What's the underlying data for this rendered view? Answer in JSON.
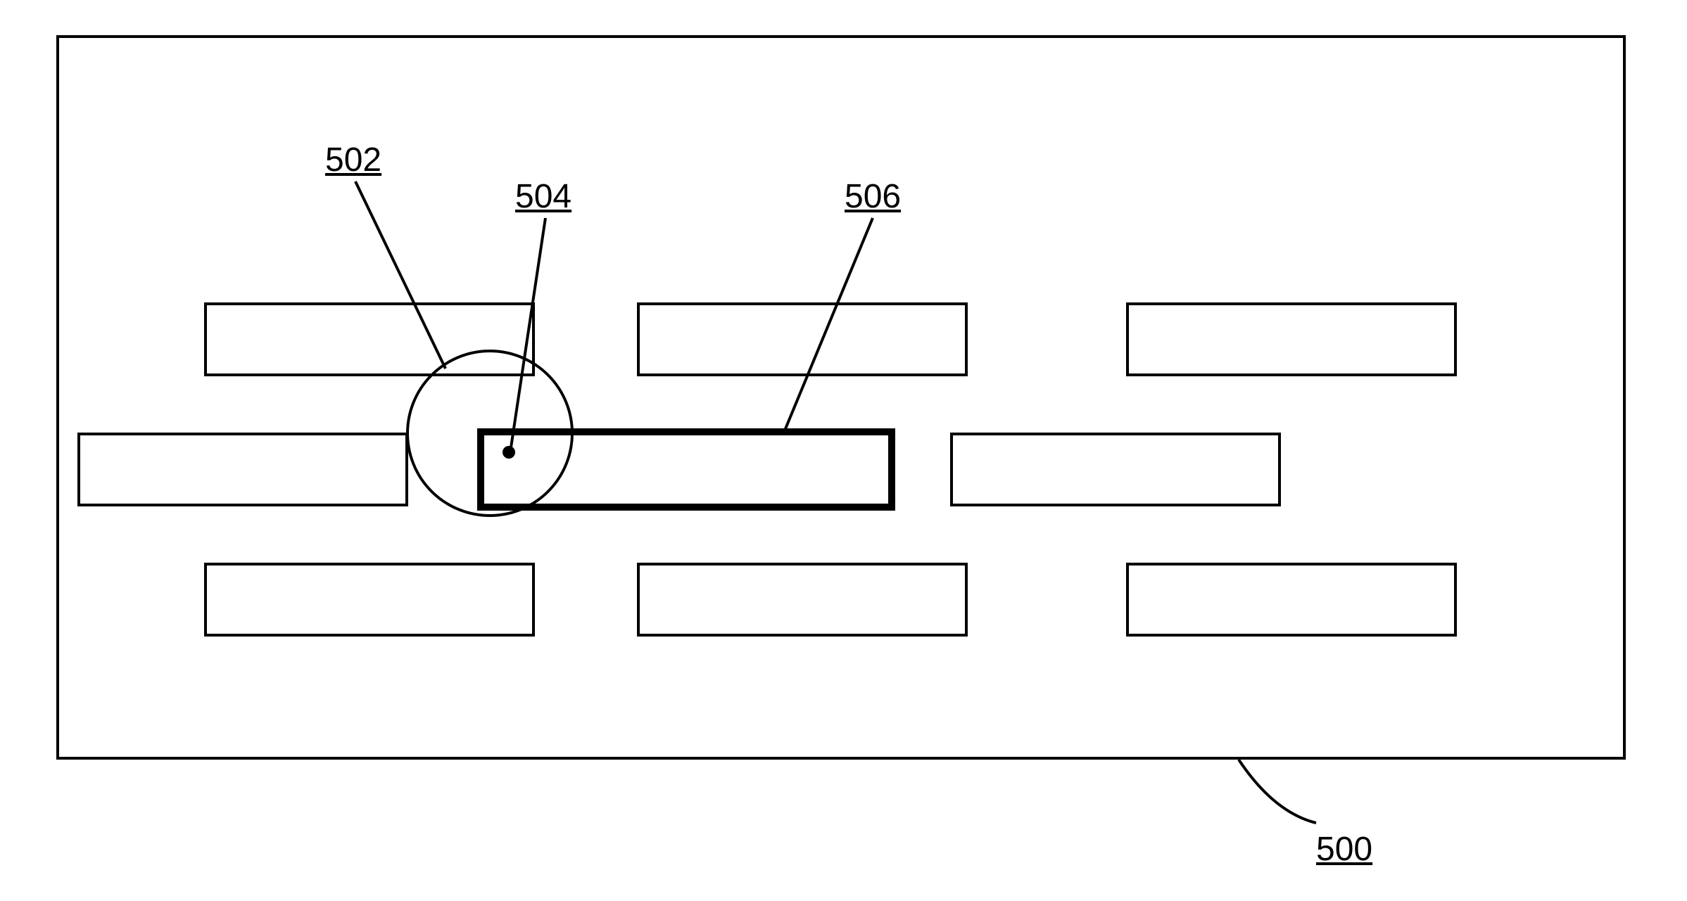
{
  "labels": {
    "ref502": "502",
    "ref504": "504",
    "ref506": "506",
    "ref500": "500"
  }
}
